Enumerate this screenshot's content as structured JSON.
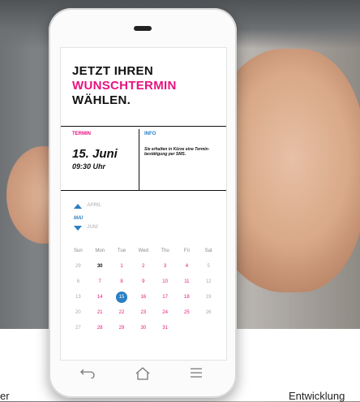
{
  "screen": {
    "headline_line1": "JETZT IHREN",
    "headline_line2": "WUNSCHTERMIN",
    "headline_line3": "WÄHLEN.",
    "termin_label": "TERMIN",
    "info_label": "INFO",
    "date": "15. Juni",
    "time": "09:30 Uhr",
    "info_text": "Sie erhalten in Kürze eine Termin-bestätigung per SMS.",
    "months": {
      "prev": "APRIL",
      "current": "MAI",
      "next": "JUNI"
    },
    "weekdays": [
      "Sun",
      "Mon",
      "Tue",
      "Wed",
      "Thu",
      "Fri",
      "Sat"
    ],
    "weeks": [
      [
        "29",
        "30",
        "1",
        "2",
        "3",
        "4",
        "5"
      ],
      [
        "6",
        "7",
        "8",
        "9",
        "10",
        "11",
        "12"
      ],
      [
        "13",
        "14",
        "15",
        "16",
        "17",
        "18",
        "19"
      ],
      [
        "20",
        "21",
        "22",
        "23",
        "24",
        "25",
        "26"
      ],
      [
        "27",
        "28",
        "29",
        "30",
        "31",
        "",
        ""
      ]
    ],
    "selected_day": "15"
  },
  "captions": {
    "left": "er",
    "right": "Entwicklung"
  },
  "nav": {
    "back_icon": "back-arrow-icon",
    "home_icon": "home-icon",
    "menu_icon": "menu-icon"
  },
  "colors": {
    "accent_pink": "#e8137f",
    "accent_blue": "#2a7fc4"
  }
}
